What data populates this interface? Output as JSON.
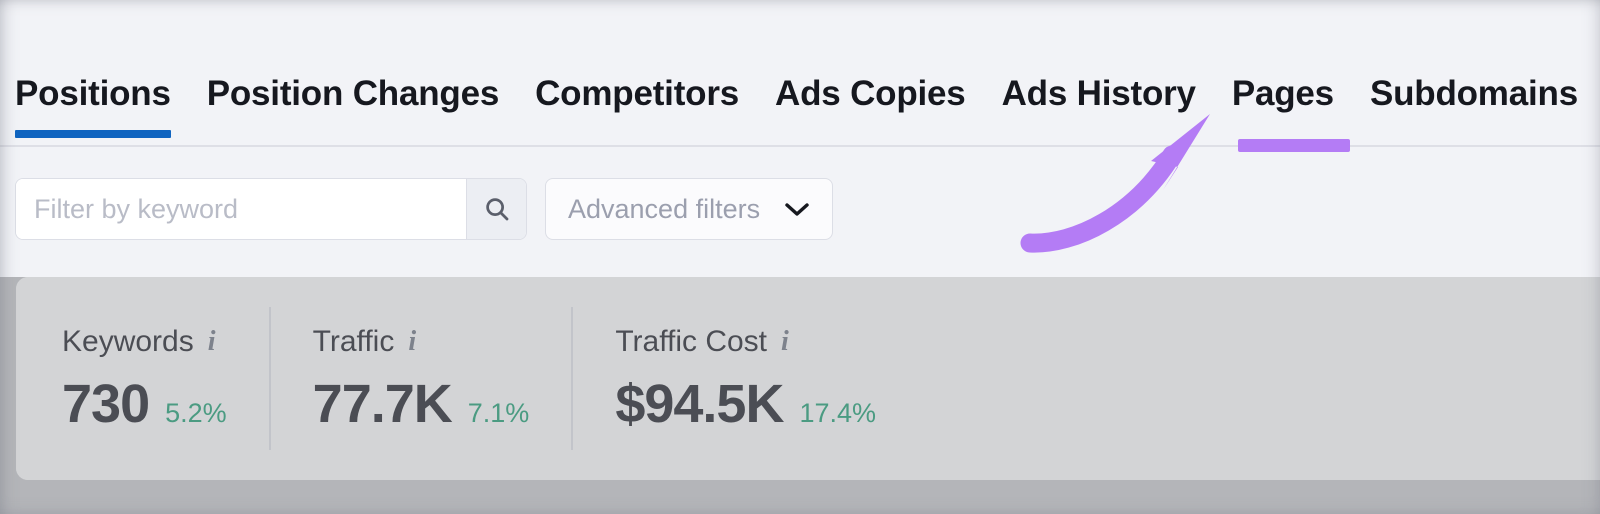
{
  "theme": {
    "page_bg": "#f2f3f7",
    "active_tab_color": "#1064c0",
    "annotation_color": "#b47cf5",
    "delta_color": "#169e6f",
    "text_color": "#16181f",
    "placeholder_color": "#b9bcc7",
    "overlay_gray": "#b4b5b9"
  },
  "tabs": [
    {
      "label": "Positions",
      "active": true
    },
    {
      "label": "Position Changes",
      "active": false
    },
    {
      "label": "Competitors",
      "active": false
    },
    {
      "label": "Ads Copies",
      "active": false
    },
    {
      "label": "Ads History",
      "active": false
    },
    {
      "label": "Pages",
      "active": false
    },
    {
      "label": "Subdomains",
      "active": false
    }
  ],
  "filters": {
    "search": {
      "value": "",
      "placeholder": "Filter by keyword",
      "icon": "search-icon"
    },
    "advanced": {
      "label": "Advanced filters",
      "icon": "chevron-down-icon"
    }
  },
  "metrics": [
    {
      "title": "Keywords",
      "value": "730",
      "delta": "5.2%",
      "info_icon": "info-icon"
    },
    {
      "title": "Traffic",
      "value": "77.7K",
      "delta": "7.1%",
      "info_icon": "info-icon"
    },
    {
      "title": "Traffic Cost",
      "value": "$94.5K",
      "delta": "17.4%",
      "info_icon": "info-icon"
    }
  ],
  "annotation": {
    "type": "curved-arrow",
    "points_to": "Pages",
    "color": "#b47cf5",
    "underline_target": "Pages"
  }
}
